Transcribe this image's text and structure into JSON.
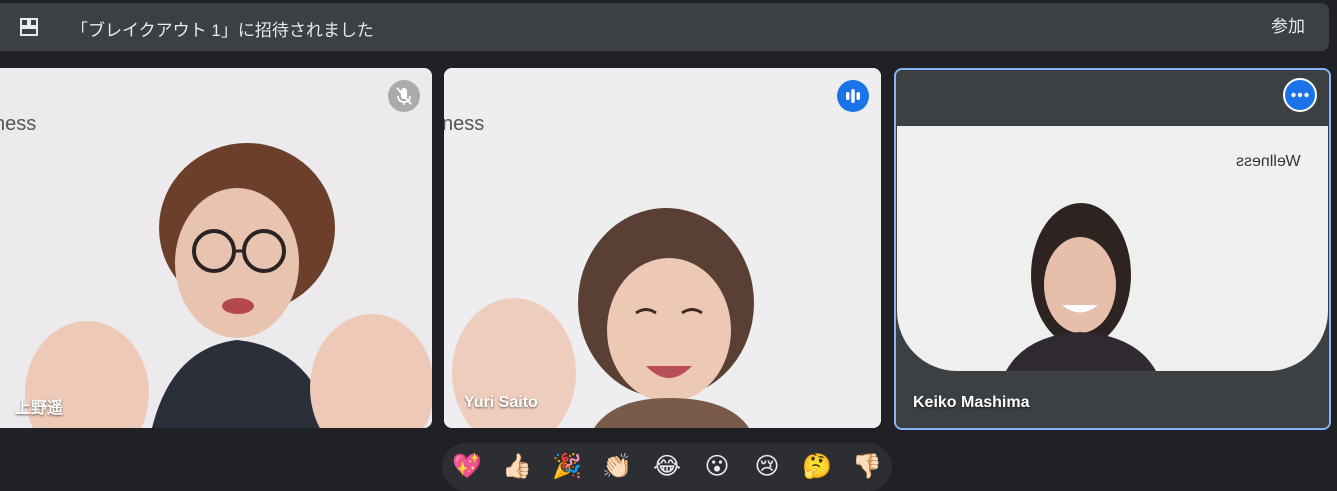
{
  "banner": {
    "message": "「ブレイクアウト 1」に招待されました",
    "join_label": "参加"
  },
  "participants": [
    {
      "name": "上野遥",
      "status": "muted",
      "backdrop_text": "ness"
    },
    {
      "name": "Yuri Saito",
      "status": "speaking",
      "backdrop_text": "ness"
    },
    {
      "name": "Keiko Mashima",
      "status": "pinned",
      "backdrop_text": "Wellness"
    }
  ],
  "reactions": [
    {
      "name": "sparkling-heart",
      "glyph": "💖"
    },
    {
      "name": "thumbs-up",
      "glyph": "👍🏻"
    },
    {
      "name": "party-popper",
      "glyph": "🎉"
    },
    {
      "name": "clapping-hands",
      "glyph": "👏🏻"
    },
    {
      "name": "tears-of-joy",
      "glyph": "😂"
    },
    {
      "name": "surprised",
      "glyph": "😮"
    },
    {
      "name": "crying",
      "glyph": "😢"
    },
    {
      "name": "thinking",
      "glyph": "🤔"
    },
    {
      "name": "thumbs-down",
      "glyph": "👎🏻"
    }
  ],
  "colors": {
    "accent": "#1a73e8",
    "pinned_border": "#8ab4f8",
    "background": "#202124",
    "surface": "#3c4043"
  }
}
